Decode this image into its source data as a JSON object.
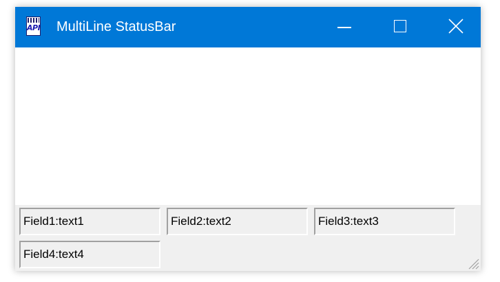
{
  "window": {
    "title": "MultiLine StatusBar",
    "icon": "api-app-icon",
    "icon_text": "API",
    "accent_color": "#0078d7"
  },
  "caption_buttons": {
    "minimize": "minimize-icon",
    "maximize": "maximize-icon",
    "close": "close-icon"
  },
  "statusbar": {
    "fields": [
      {
        "label": "Field1:text1"
      },
      {
        "label": "Field2:text2"
      },
      {
        "label": "Field3:text3"
      },
      {
        "label": "Field4:text4"
      }
    ],
    "size_grip": "resize-grip-icon"
  }
}
